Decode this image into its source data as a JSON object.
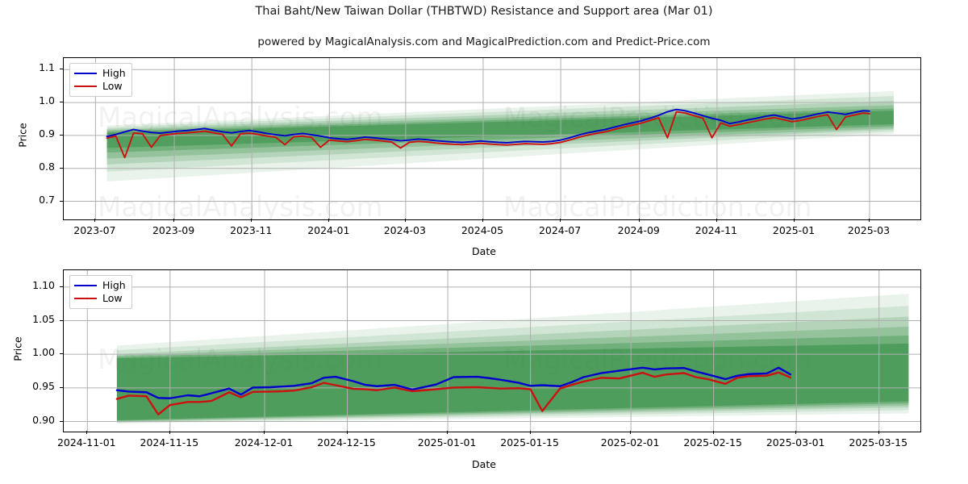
{
  "header": {
    "title": "Thai Baht/New Taiwan Dollar (THBTWD) Resistance and Support area (Mar 01)",
    "subtitle": "powered by MagicalAnalysis.com and MagicalPrediction.com and Predict-Price.com"
  },
  "watermarks": {
    "analysis": "MagicalAnalysis.com",
    "prediction": "MagicalPrediction.com"
  },
  "colors": {
    "high": "#0000cc",
    "low": "#cc1111",
    "band": "#2e8b3f",
    "grid": "#b0b0b0",
    "axis": "#000000",
    "background": "#ffffff"
  },
  "chart_data": [
    {
      "id": "overview",
      "type": "line",
      "title": "Thai Baht/New Taiwan Dollar (THBTWD) Resistance and Support area (Mar 01)",
      "xlabel": "Date",
      "ylabel": "Price",
      "ylim": [
        0.645,
        1.135
      ],
      "yticks": [
        0.7,
        0.8,
        0.9,
        1.0,
        1.1
      ],
      "ytick_labels": [
        "0.7",
        "0.8",
        "0.9",
        "1.0",
        "1.1"
      ],
      "xlim": [
        "2023-06-06",
        "2025-04-10"
      ],
      "xticks": [
        "2023-07",
        "2023-09",
        "2023-11",
        "2024-01",
        "2024-03",
        "2024-05",
        "2024-07",
        "2024-09",
        "2024-11",
        "2025-01",
        "2025-03"
      ],
      "grid": true,
      "legend": {
        "position": "upper-left",
        "entries": [
          "High",
          "Low"
        ]
      },
      "series": [
        {
          "name": "High",
          "color": "#0000cc",
          "x": [
            "2023-07-10",
            "2023-07-17",
            "2023-07-24",
            "2023-07-31",
            "2023-08-07",
            "2023-08-14",
            "2023-08-21",
            "2023-08-28",
            "2023-09-04",
            "2023-09-11",
            "2023-09-18",
            "2023-09-25",
            "2023-10-02",
            "2023-10-09",
            "2023-10-16",
            "2023-10-23",
            "2023-10-30",
            "2023-11-06",
            "2023-11-13",
            "2023-11-20",
            "2023-11-27",
            "2023-12-04",
            "2023-12-11",
            "2023-12-18",
            "2023-12-25",
            "2024-01-01",
            "2024-01-08",
            "2024-01-15",
            "2024-01-22",
            "2024-01-29",
            "2024-02-05",
            "2024-02-12",
            "2024-02-19",
            "2024-02-26",
            "2024-03-04",
            "2024-03-11",
            "2024-03-18",
            "2024-03-25",
            "2024-04-01",
            "2024-04-08",
            "2024-04-15",
            "2024-04-22",
            "2024-04-29",
            "2024-05-06",
            "2024-05-13",
            "2024-05-20",
            "2024-05-27",
            "2024-06-03",
            "2024-06-10",
            "2024-06-17",
            "2024-06-24",
            "2024-07-01",
            "2024-07-08",
            "2024-07-15",
            "2024-07-22",
            "2024-07-29",
            "2024-08-05",
            "2024-08-12",
            "2024-08-19",
            "2024-08-26",
            "2024-09-02",
            "2024-09-09",
            "2024-09-16",
            "2024-09-23",
            "2024-09-30",
            "2024-10-07",
            "2024-10-14",
            "2024-10-21",
            "2024-10-28",
            "2024-11-04",
            "2024-11-11",
            "2024-11-18",
            "2024-11-25",
            "2024-12-02",
            "2024-12-09",
            "2024-12-16",
            "2024-12-23",
            "2024-12-30",
            "2025-01-06",
            "2025-01-13",
            "2025-01-20",
            "2025-01-27",
            "2025-02-03",
            "2025-02-10",
            "2025-02-17",
            "2025-02-24",
            "2025-03-01"
          ],
          "y": [
            0.897,
            0.903,
            0.911,
            0.918,
            0.913,
            0.909,
            0.907,
            0.91,
            0.913,
            0.915,
            0.918,
            0.921,
            0.916,
            0.911,
            0.908,
            0.912,
            0.915,
            0.911,
            0.906,
            0.902,
            0.899,
            0.903,
            0.906,
            0.902,
            0.898,
            0.893,
            0.89,
            0.888,
            0.891,
            0.895,
            0.893,
            0.89,
            0.887,
            0.884,
            0.886,
            0.889,
            0.887,
            0.884,
            0.882,
            0.88,
            0.879,
            0.881,
            0.883,
            0.881,
            0.879,
            0.878,
            0.88,
            0.882,
            0.881,
            0.88,
            0.882,
            0.886,
            0.893,
            0.901,
            0.908,
            0.913,
            0.918,
            0.925,
            0.932,
            0.938,
            0.944,
            0.952,
            0.961,
            0.972,
            0.979,
            0.975,
            0.968,
            0.96,
            0.952,
            0.946,
            0.936,
            0.941,
            0.947,
            0.952,
            0.958,
            0.962,
            0.956,
            0.95,
            0.954,
            0.96,
            0.966,
            0.971,
            0.968,
            0.964,
            0.97,
            0.975,
            0.974
          ]
        },
        {
          "name": "Low",
          "color": "#cc1111",
          "x": [
            "2023-07-10",
            "2023-07-17",
            "2023-07-24",
            "2023-07-31",
            "2023-08-07",
            "2023-08-14",
            "2023-08-21",
            "2023-08-28",
            "2023-09-04",
            "2023-09-11",
            "2023-09-18",
            "2023-09-25",
            "2023-10-02",
            "2023-10-09",
            "2023-10-16",
            "2023-10-23",
            "2023-10-30",
            "2023-11-06",
            "2023-11-13",
            "2023-11-20",
            "2023-11-27",
            "2023-12-04",
            "2023-12-11",
            "2023-12-18",
            "2023-12-25",
            "2024-01-01",
            "2024-01-08",
            "2024-01-15",
            "2024-01-22",
            "2024-01-29",
            "2024-02-05",
            "2024-02-12",
            "2024-02-19",
            "2024-02-26",
            "2024-03-04",
            "2024-03-11",
            "2024-03-18",
            "2024-03-25",
            "2024-04-01",
            "2024-04-08",
            "2024-04-15",
            "2024-04-22",
            "2024-04-29",
            "2024-05-06",
            "2024-05-13",
            "2024-05-20",
            "2024-05-27",
            "2024-06-03",
            "2024-06-10",
            "2024-06-17",
            "2024-06-24",
            "2024-07-01",
            "2024-07-08",
            "2024-07-15",
            "2024-07-22",
            "2024-07-29",
            "2024-08-05",
            "2024-08-12",
            "2024-08-19",
            "2024-08-26",
            "2024-09-02",
            "2024-09-09",
            "2024-09-16",
            "2024-09-23",
            "2024-09-30",
            "2024-10-07",
            "2024-10-14",
            "2024-10-21",
            "2024-10-28",
            "2024-11-04",
            "2024-11-11",
            "2024-11-18",
            "2024-11-25",
            "2024-12-02",
            "2024-12-09",
            "2024-12-16",
            "2024-12-23",
            "2024-12-30",
            "2025-01-06",
            "2025-01-13",
            "2025-01-20",
            "2025-01-27",
            "2025-02-03",
            "2025-02-10",
            "2025-02-17",
            "2025-02-24",
            "2025-03-01"
          ],
          "y": [
            0.892,
            0.898,
            0.833,
            0.908,
            0.905,
            0.864,
            0.9,
            0.903,
            0.906,
            0.908,
            0.91,
            0.913,
            0.908,
            0.903,
            0.868,
            0.905,
            0.907,
            0.903,
            0.898,
            0.894,
            0.872,
            0.896,
            0.898,
            0.894,
            0.864,
            0.886,
            0.883,
            0.881,
            0.884,
            0.888,
            0.886,
            0.883,
            0.88,
            0.862,
            0.879,
            0.882,
            0.88,
            0.877,
            0.875,
            0.873,
            0.872,
            0.874,
            0.876,
            0.874,
            0.872,
            0.871,
            0.873,
            0.875,
            0.874,
            0.873,
            0.875,
            0.879,
            0.886,
            0.894,
            0.901,
            0.906,
            0.911,
            0.918,
            0.925,
            0.931,
            0.937,
            0.945,
            0.954,
            0.893,
            0.972,
            0.968,
            0.96,
            0.952,
            0.893,
            0.938,
            0.928,
            0.933,
            0.939,
            0.944,
            0.95,
            0.954,
            0.948,
            0.942,
            0.946,
            0.952,
            0.958,
            0.963,
            0.918,
            0.956,
            0.962,
            0.968,
            0.966
          ]
        }
      ],
      "bands": {
        "description": "Fanning green resistance/support cone widening to the right",
        "color": "#2e8b3f",
        "layers": 6
      }
    },
    {
      "id": "detail",
      "type": "line",
      "xlabel": "Date",
      "ylabel": "Price",
      "ylim": [
        0.885,
        1.125
      ],
      "yticks": [
        0.9,
        0.95,
        1.0,
        1.05,
        1.1
      ],
      "ytick_labels": [
        "0.90",
        "0.95",
        "1.00",
        "1.05",
        "1.10"
      ],
      "xlim": [
        "2024-10-28",
        "2025-03-22"
      ],
      "xticks": [
        "2024-11-01",
        "2024-11-15",
        "2024-12-01",
        "2024-12-15",
        "2025-01-01",
        "2025-01-15",
        "2025-02-01",
        "2025-02-15",
        "2025-03-01",
        "2025-03-15"
      ],
      "grid": true,
      "legend": {
        "position": "upper-left",
        "entries": [
          "High",
          "Low"
        ]
      },
      "series": [
        {
          "name": "High",
          "color": "#0000cc",
          "x": [
            "2024-11-06",
            "2024-11-08",
            "2024-11-11",
            "2024-11-13",
            "2024-11-15",
            "2024-11-18",
            "2024-11-20",
            "2024-11-22",
            "2024-11-25",
            "2024-11-27",
            "2024-11-29",
            "2024-12-02",
            "2024-12-04",
            "2024-12-06",
            "2024-12-09",
            "2024-12-11",
            "2024-12-13",
            "2024-12-16",
            "2024-12-18",
            "2024-12-20",
            "2024-12-23",
            "2024-12-26",
            "2024-12-30",
            "2025-01-02",
            "2025-01-06",
            "2025-01-08",
            "2025-01-10",
            "2025-01-13",
            "2025-01-15",
            "2025-01-17",
            "2025-01-20",
            "2025-01-22",
            "2025-01-24",
            "2025-01-27",
            "2025-01-30",
            "2025-02-03",
            "2025-02-05",
            "2025-02-07",
            "2025-02-10",
            "2025-02-12",
            "2025-02-14",
            "2025-02-17",
            "2025-02-19",
            "2025-02-21",
            "2025-02-24",
            "2025-02-26",
            "2025-02-28"
          ],
          "y": [
            0.9465,
            0.9445,
            0.9435,
            0.935,
            0.9345,
            0.939,
            0.9375,
            0.942,
            0.949,
            0.94,
            0.9505,
            0.951,
            0.952,
            0.953,
            0.957,
            0.965,
            0.9665,
            0.96,
            0.9545,
            0.9525,
            0.9545,
            0.9475,
            0.955,
            0.966,
            0.9665,
            0.9645,
            0.962,
            0.9575,
            0.953,
            0.954,
            0.9525,
            0.9585,
            0.966,
            0.972,
            0.9755,
            0.98,
            0.9775,
            0.979,
            0.9795,
            0.9745,
            0.97,
            0.963,
            0.968,
            0.9705,
            0.9715,
            0.98,
            0.97
          ]
        },
        {
          "name": "Low",
          "color": "#cc1111",
          "x": [
            "2024-11-06",
            "2024-11-08",
            "2024-11-11",
            "2024-11-13",
            "2024-11-15",
            "2024-11-18",
            "2024-11-20",
            "2024-11-22",
            "2024-11-25",
            "2024-11-27",
            "2024-11-29",
            "2024-12-02",
            "2024-12-04",
            "2024-12-06",
            "2024-12-09",
            "2024-12-11",
            "2024-12-13",
            "2024-12-16",
            "2024-12-18",
            "2024-12-20",
            "2024-12-23",
            "2024-12-26",
            "2024-12-30",
            "2025-01-02",
            "2025-01-06",
            "2025-01-08",
            "2025-01-10",
            "2025-01-13",
            "2025-01-15",
            "2025-01-17",
            "2025-01-20",
            "2025-01-22",
            "2025-01-24",
            "2025-01-27",
            "2025-01-30",
            "2025-02-03",
            "2025-02-05",
            "2025-02-07",
            "2025-02-10",
            "2025-02-12",
            "2025-02-14",
            "2025-02-17",
            "2025-02-19",
            "2025-02-21",
            "2025-02-24",
            "2025-02-26",
            "2025-02-28"
          ],
          "y": [
            0.9335,
            0.9385,
            0.9375,
            0.9105,
            0.9245,
            0.929,
            0.929,
            0.9305,
            0.9435,
            0.936,
            0.944,
            0.9445,
            0.945,
            0.946,
            0.951,
            0.9575,
            0.954,
            0.9485,
            0.948,
            0.9465,
            0.9505,
            0.945,
            0.948,
            0.9505,
            0.951,
            0.95,
            0.949,
            0.9495,
            0.948,
            0.9155,
            0.949,
            0.9545,
            0.9595,
            0.965,
            0.964,
            0.9725,
            0.9665,
            0.97,
            0.972,
            0.966,
            0.963,
            0.956,
            0.965,
            0.9675,
            0.968,
            0.973,
            0.9655
          ]
        }
      ],
      "bands": {
        "description": "Fanning green resistance/support cone widening to the right",
        "color": "#2e8b3f",
        "layers": 6
      }
    }
  ]
}
